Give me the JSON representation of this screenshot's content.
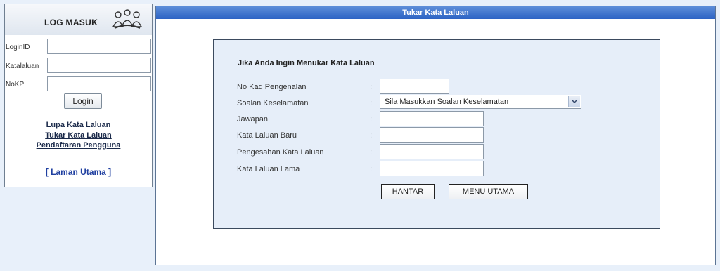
{
  "login": {
    "title": "LOG MASUK",
    "logo_icon": "people-logo-icon",
    "loginid_label": "LoginID",
    "password_label": "Katalaluan",
    "nokp_label": "NoKP",
    "loginid_value": "",
    "password_value": "",
    "nokp_value": "",
    "button_label": "Login",
    "links": [
      "Lupa Kata Laluan",
      "Tukar Kata Laluan",
      "Pendaftaran Pengguna"
    ],
    "home_link": "[ Laman Utama ]"
  },
  "main": {
    "title": "Tukar Kata Laluan",
    "form": {
      "heading": "Jika Anda Ingin Menukar Kata Laluan",
      "colon": ":",
      "fields": [
        {
          "label": "No Kad Pengenalan",
          "value": ""
        },
        {
          "label": "Soalan Keselamatan",
          "value": "Sila Masukkan Soalan Keselamatan"
        },
        {
          "label": "Jawapan",
          "value": ""
        },
        {
          "label": "Kata Laluan Baru",
          "value": ""
        },
        {
          "label": "Pengesahan Kata Laluan",
          "value": ""
        },
        {
          "label": "Kata Laluan Lama",
          "value": ""
        }
      ],
      "submit_label": "HANTAR",
      "menu_label": "MENU UTAMA"
    }
  },
  "colors": {
    "page_bg": "#e8f0fa",
    "titlebar_blue": "#2c63c4",
    "form_bg": "#e6eef9",
    "link_blue": "#1f3fa0"
  }
}
